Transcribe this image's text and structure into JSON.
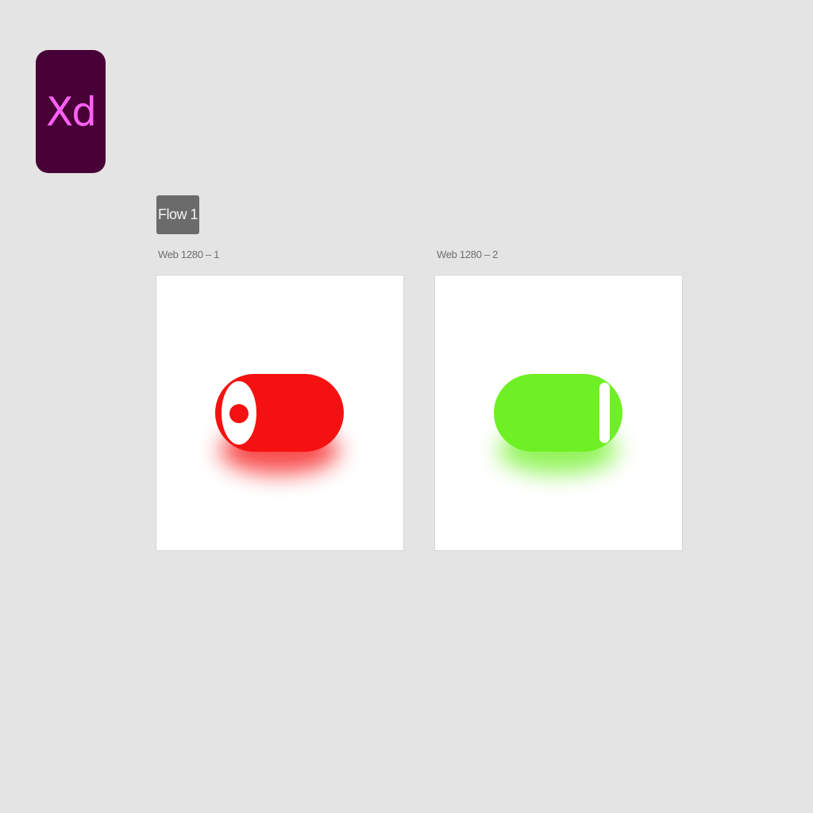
{
  "app": {
    "logo_text": "Xd",
    "logo_bg": "#470137",
    "logo_fg": "#ff61f6"
  },
  "canvas": {
    "background": "#e4e4e4",
    "flow_label": "Flow 1"
  },
  "artboards": [
    {
      "title": "Web 1280 – 1",
      "toggle": {
        "state": "off",
        "color": "#f51111",
        "knob_icon": "circle-knob-icon"
      }
    },
    {
      "title": "Web 1280 – 2",
      "toggle": {
        "state": "on",
        "color": "#6ef024",
        "knob_icon": "bar-knob-icon"
      }
    }
  ]
}
